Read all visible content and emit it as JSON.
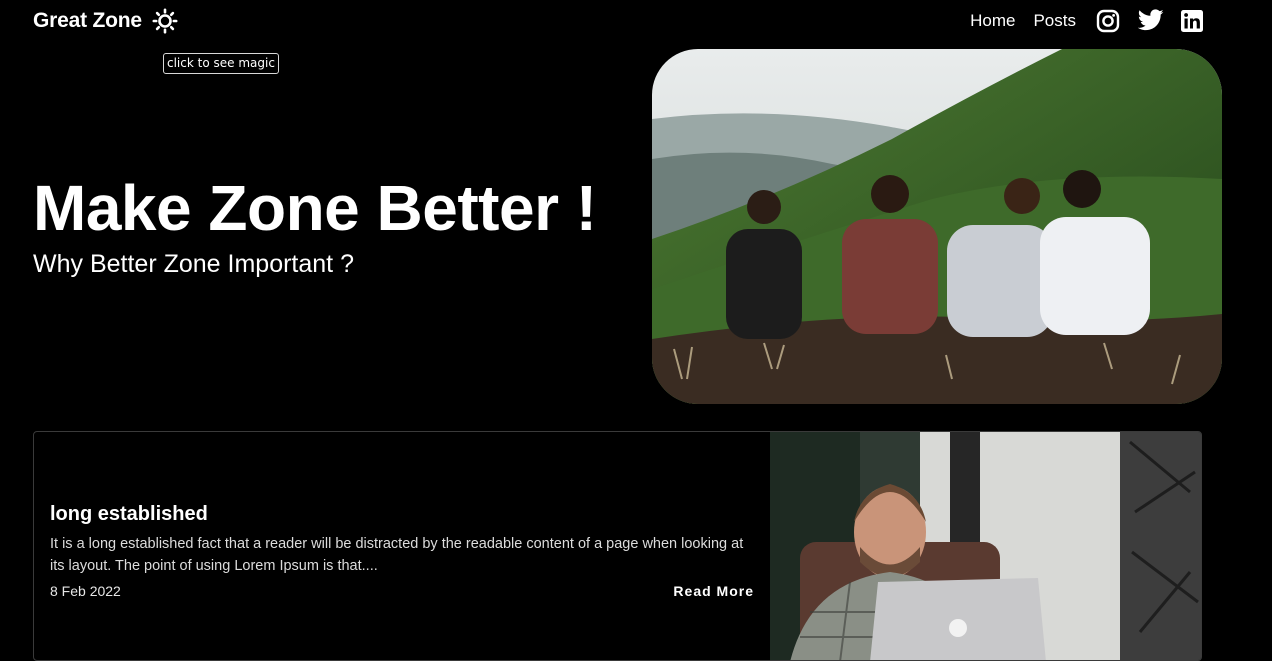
{
  "brand": {
    "name": "Great Zone",
    "theme_icon": "sun-icon",
    "tooltip": "click to see magic"
  },
  "nav": {
    "links": [
      {
        "label": "Home"
      },
      {
        "label": "Posts"
      }
    ],
    "social": [
      "instagram-icon",
      "twitter-icon",
      "linkedin-icon"
    ]
  },
  "hero": {
    "title": "Make Zone Better !",
    "subtitle": "Why Better Zone Important ?"
  },
  "posts": [
    {
      "title": "long established",
      "excerpt": "It is a long established fact that a reader will be distracted by the readable content of a page when looking at its layout. The point of using Lorem Ipsum is that....",
      "date": "8 Feb 2022",
      "cta": "Read More"
    }
  ],
  "colors": {
    "background": "#000000",
    "text": "#ffffff",
    "card_border": "#3a3a3a"
  }
}
